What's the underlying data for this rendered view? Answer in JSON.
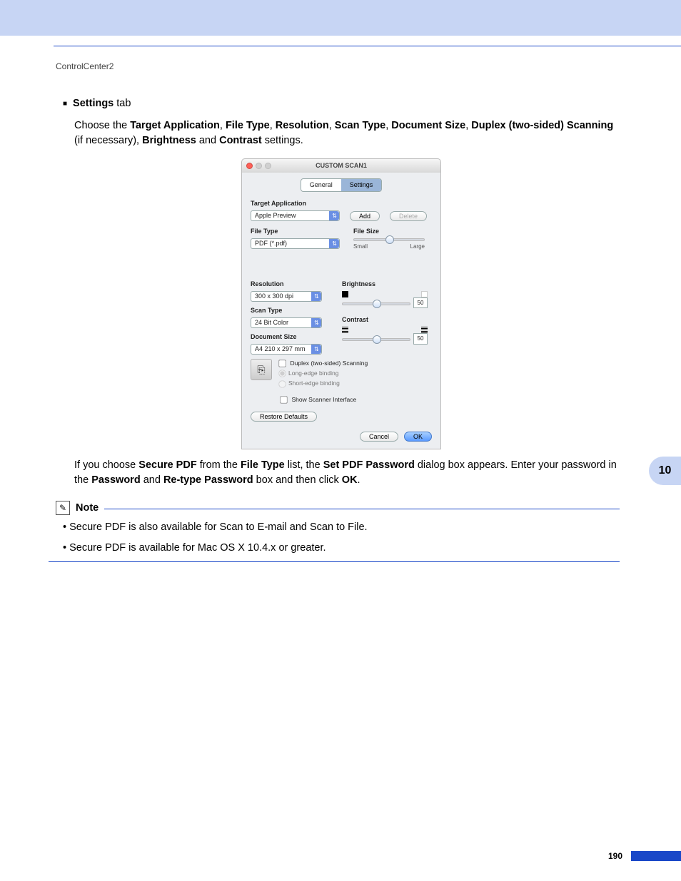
{
  "page": {
    "header": "ControlCenter2",
    "chapter_tab": "10",
    "page_number": "190"
  },
  "section": {
    "title_bold": "Settings",
    "title_rest": " tab",
    "para1_pre": "Choose the ",
    "targets": [
      "Target Application",
      "File Type",
      "Resolution",
      "Scan Type",
      "Document Size",
      "Duplex (two-sided) Scanning"
    ],
    "para1_mid1": " (if necessary), ",
    "b_brightness": "Brightness",
    "para1_and": " and ",
    "b_contrast": "Contrast",
    "para1_end": " settings.",
    "after_para": {
      "p1": "If you choose ",
      "b1": "Secure PDF",
      "p2": " from the ",
      "b2": "File Type",
      "p3": " list, the ",
      "b3": "Set PDF Password",
      "p4": " dialog box appears. Enter your password in the ",
      "b4": "Password",
      "p5": " and ",
      "b5": "Re-type Password",
      "p6": " box and then click ",
      "b6": "OK",
      "p7": "."
    }
  },
  "note": {
    "title": "Note",
    "items": [
      "Secure PDF is also available for Scan to E-mail and Scan to File.",
      "Secure PDF is available for Mac OS X 10.4.x or greater."
    ]
  },
  "dialog": {
    "title": "CUSTOM SCAN1",
    "tab_general": "General",
    "tab_settings": "Settings",
    "target_app_label": "Target Application",
    "target_app_value": "Apple Preview",
    "add_btn": "Add",
    "delete_btn": "Delete",
    "file_type_label": "File Type",
    "file_type_value": "PDF (*.pdf)",
    "file_size_label": "File Size",
    "file_size_small": "Small",
    "file_size_large": "Large",
    "resolution_label": "Resolution",
    "resolution_value": "300 x 300 dpi",
    "scan_type_label": "Scan Type",
    "scan_type_value": "24 Bit Color",
    "doc_size_label": "Document Size",
    "doc_size_value": "A4  210 x 297 mm",
    "brightness_label": "Brightness",
    "contrast_label": "Contrast",
    "brightness_value": "50",
    "contrast_value": "50",
    "duplex_label": "Duplex (two-sided) Scanning",
    "long_edge": "Long-edge binding",
    "short_edge": "Short-edge binding",
    "show_scanner": "Show Scanner Interface",
    "restore": "Restore Defaults",
    "cancel": "Cancel",
    "ok": "OK"
  }
}
